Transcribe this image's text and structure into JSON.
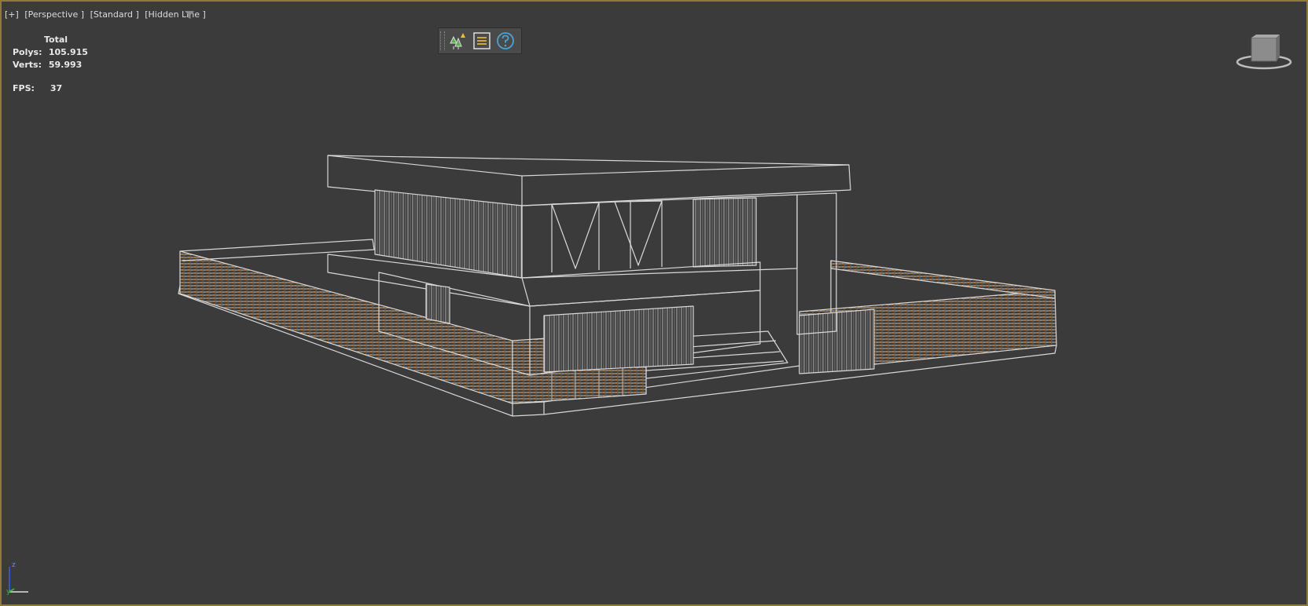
{
  "viewport": {
    "label_parts": [
      "[+]",
      "[Perspective ]",
      "[Standard ]",
      "[Hidden Line ]"
    ],
    "border_color": "#8f7a3c",
    "background": "#3b3b3b"
  },
  "stats": {
    "header": "Total",
    "polys_label": "Polys:",
    "polys_value": "105.915",
    "verts_label": "Verts:",
    "verts_value": "59.993",
    "fps_label": "FPS:",
    "fps_value": "37"
  },
  "toolbar": {
    "buttons": [
      {
        "icon": "scene-explorer-icon"
      },
      {
        "icon": "list-icon"
      },
      {
        "icon": "help-icon"
      }
    ]
  },
  "icons": {
    "filter": "filter-icon",
    "viewcube": "viewcube-icon",
    "axis": "axis-tripod-icon"
  },
  "axis": {
    "z": "z",
    "y": "y",
    "x": "x"
  },
  "colors": {
    "wire": "#d8d8d8",
    "fence_wood": "#b47a3a",
    "accent_yellow": "#f0c030",
    "accent_green": "#5bb050",
    "help_blue": "#4aa3d6"
  }
}
